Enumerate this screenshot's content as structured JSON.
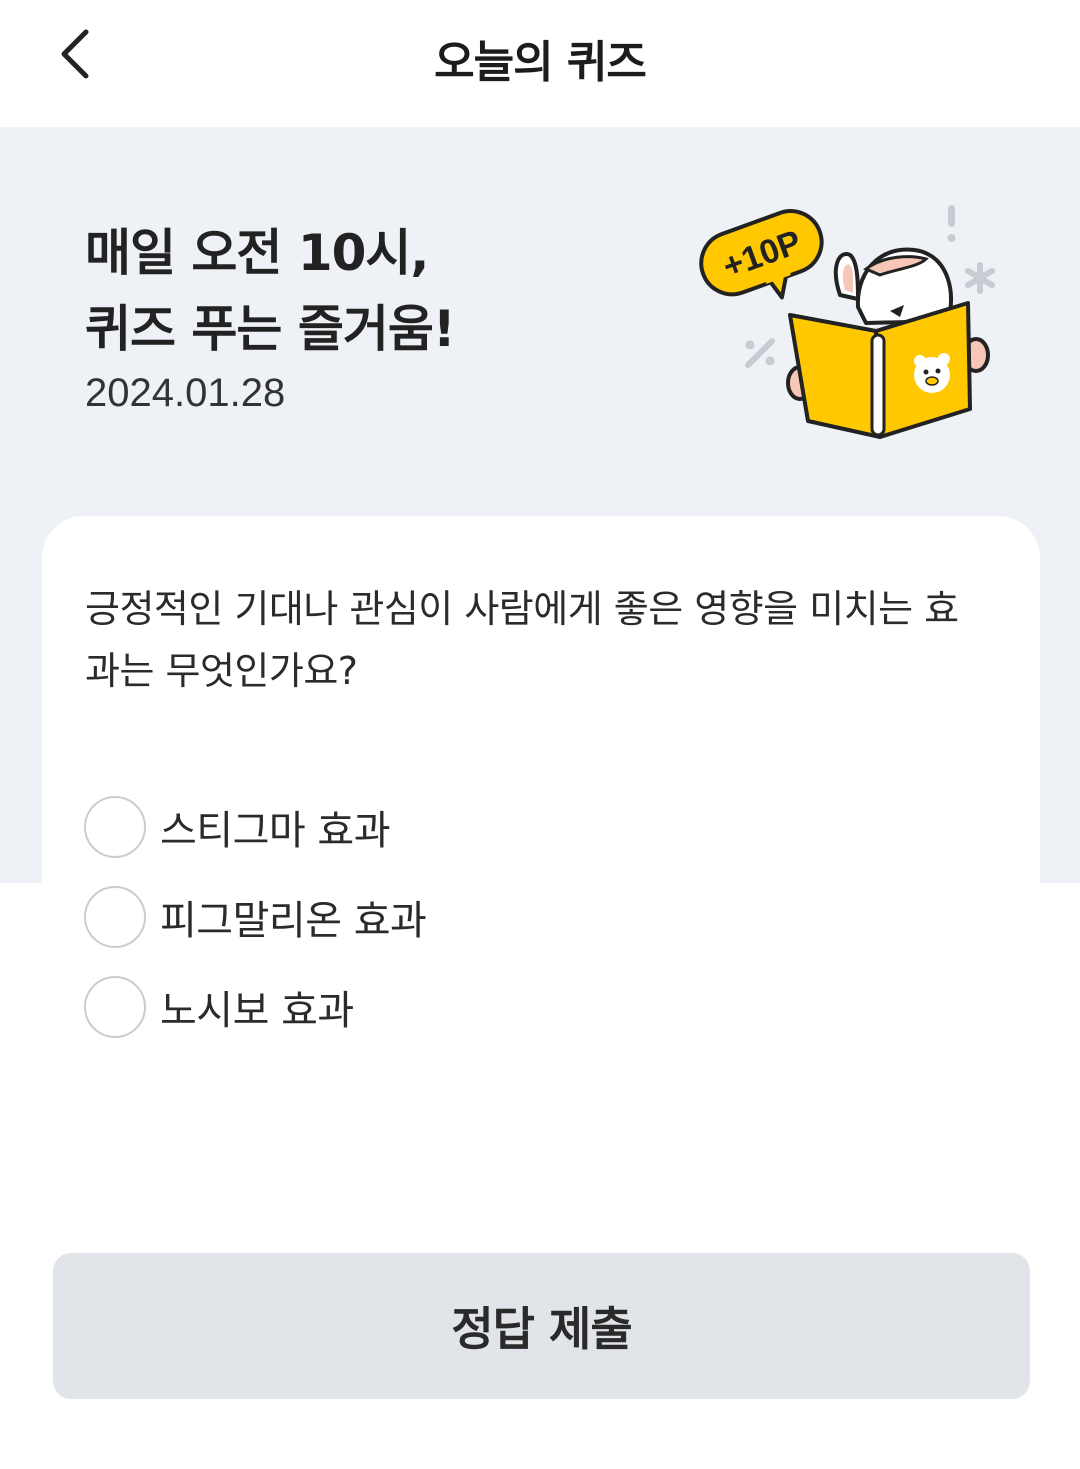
{
  "header": {
    "back_icon": "chevron-left-icon",
    "title": "오늘의 퀴즈"
  },
  "hero": {
    "title_line1": "매일 오전 10시,",
    "title_line2": "퀴즈 푸는 즐거움!",
    "date": "2024.01.28",
    "badge_text": "+10P",
    "illustration": "rabbit-reading-book-illustration"
  },
  "quiz": {
    "question": "긍정적인 기대나 관심이 사람에게 좋은 영향을 미치는 효과는 무엇인가요?",
    "options": [
      {
        "label": "스티그마 효과",
        "selected": false
      },
      {
        "label": "피그말리온 효과",
        "selected": false
      },
      {
        "label": "노시보 효과",
        "selected": false
      }
    ]
  },
  "submit": {
    "label": "정답 제출"
  },
  "colors": {
    "hero_bg": "#eef1f6",
    "accent_yellow": "#ffc800",
    "button_bg": "#e1e4e8"
  }
}
